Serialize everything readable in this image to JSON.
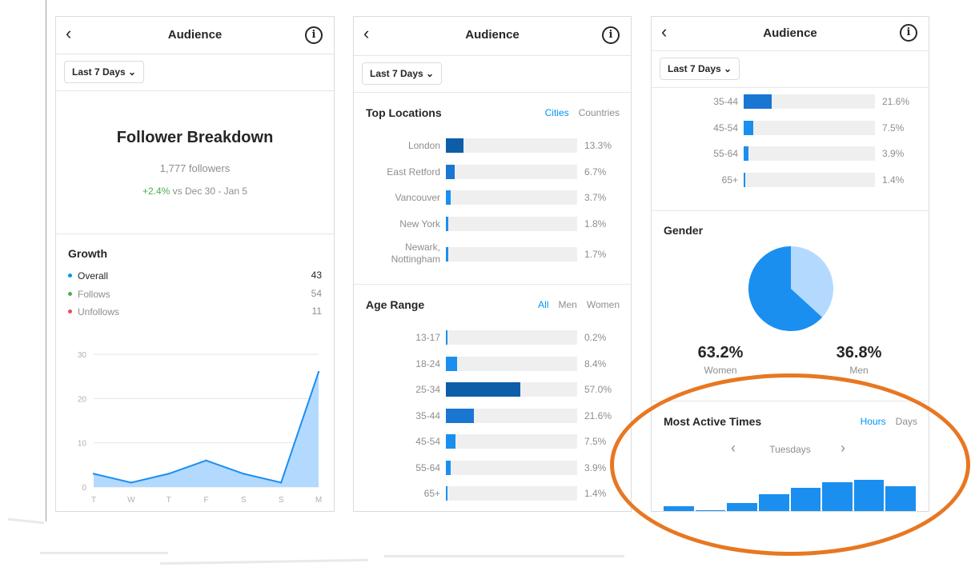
{
  "common": {
    "title": "Audience",
    "back_glyph": "‹",
    "info_glyph": "i",
    "range": "Last 7 Days ⌄"
  },
  "panel1": {
    "breakdown_title": "Follower Breakdown",
    "followers": "1,777 followers",
    "change_value": "+2.4%",
    "change_text": "vs Dec 30 - Jan 5",
    "growth_title": "Growth",
    "legend": [
      {
        "label": "Overall",
        "value": "43",
        "color": "#0095f6"
      },
      {
        "label": "Follows",
        "value": "54",
        "color": "#4caf50"
      },
      {
        "label": "Unfollows",
        "value": "11",
        "color": "#ed4956"
      }
    ],
    "chart_data": {
      "type": "area",
      "categories": [
        "T",
        "W",
        "T",
        "F",
        "S",
        "S",
        "M"
      ],
      "series": [
        {
          "values": [
            3,
            1,
            3,
            6,
            3,
            1,
            26
          ]
        }
      ],
      "yticks": [
        "30",
        "20",
        "10",
        "0"
      ],
      "ylim": [
        0,
        30
      ],
      "grid": true,
      "fill_color": "#b3d9ff",
      "line_color": "#1a8ff0"
    }
  },
  "panel2": {
    "locations_title": "Top Locations",
    "location_tabs": [
      "Cities",
      "Countries"
    ],
    "locations": [
      {
        "label": "London",
        "value": 13.3,
        "pct": "13.3%",
        "color": "#0c5ea8"
      },
      {
        "label": "East Retford",
        "value": 6.7,
        "pct": "6.7%",
        "color": "#1976d2"
      },
      {
        "label": "Vancouver",
        "value": 3.7,
        "pct": "3.7%",
        "color": "#1a8ff0"
      },
      {
        "label": "New York",
        "value": 1.8,
        "pct": "1.8%",
        "color": "#1a8ff0"
      },
      {
        "label": "Newark, Nottingham",
        "value": 1.7,
        "pct": "1.7%",
        "color": "#1a8ff0"
      }
    ],
    "age_title": "Age Range",
    "age_tabs": [
      "All",
      "Men",
      "Women"
    ],
    "ages": [
      {
        "label": "13-17",
        "value": 0.2,
        "pct": "0.2%",
        "color": "#1a8ff0"
      },
      {
        "label": "18-24",
        "value": 8.4,
        "pct": "8.4%",
        "color": "#1a8ff0"
      },
      {
        "label": "25-34",
        "value": 57.0,
        "pct": "57.0%",
        "color": "#0c5ea8"
      },
      {
        "label": "35-44",
        "value": 21.6,
        "pct": "21.6%",
        "color": "#1976d2"
      },
      {
        "label": "45-54",
        "value": 7.5,
        "pct": "7.5%",
        "color": "#1a8ff0"
      },
      {
        "label": "55-64",
        "value": 3.9,
        "pct": "3.9%",
        "color": "#1a8ff0"
      },
      {
        "label": "65+",
        "value": 1.4,
        "pct": "1.4%",
        "color": "#1a8ff0"
      }
    ]
  },
  "panel3": {
    "ages": [
      {
        "label": "35-44",
        "value": 21.6,
        "pct": "21.6%",
        "color": "#1976d2"
      },
      {
        "label": "45-54",
        "value": 7.5,
        "pct": "7.5%",
        "color": "#1a8ff0"
      },
      {
        "label": "55-64",
        "value": 3.9,
        "pct": "3.9%",
        "color": "#1a8ff0"
      },
      {
        "label": "65+",
        "value": 1.4,
        "pct": "1.4%",
        "color": "#1a8ff0"
      }
    ],
    "gender_title": "Gender",
    "women_pct": "63.2%",
    "women_label": "Women",
    "men_pct": "36.8%",
    "men_label": "Men",
    "gender_chart": {
      "women": 63.2,
      "men": 36.8,
      "women_color": "#1a8ff0",
      "men_color": "#b3d9ff"
    },
    "active_title": "Most Active Times",
    "active_tabs": [
      "Hours",
      "Days"
    ],
    "day": "Tuesdays",
    "prev_glyph": "‹",
    "next_glyph": "›",
    "hour_bars": [
      0.14,
      0.03,
      0.24,
      0.52,
      0.72,
      0.9,
      0.98,
      0.77
    ]
  },
  "annotation_color": "#e87722"
}
